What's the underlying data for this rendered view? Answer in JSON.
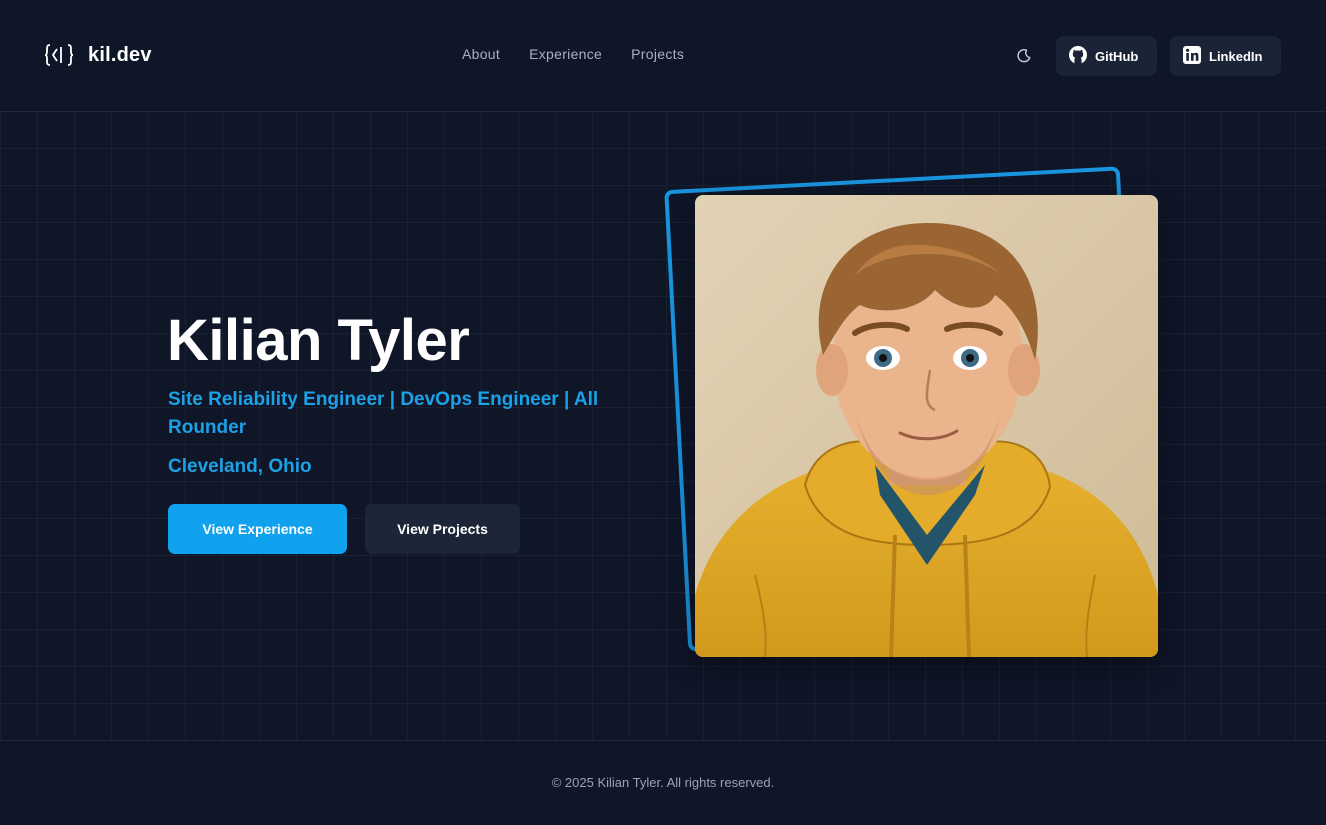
{
  "header": {
    "logo_text": "kil.dev",
    "nav": [
      {
        "label": "About"
      },
      {
        "label": "Experience"
      },
      {
        "label": "Projects"
      }
    ],
    "github_label": "GitHub",
    "linkedin_label": "LinkedIn"
  },
  "hero": {
    "name": "Kilian Tyler",
    "title": "Site Reliability Engineer | DevOps Engineer | All Rounder",
    "location": "Cleveland, Ohio",
    "primary_button": "View Experience",
    "secondary_button": "View Projects"
  },
  "footer": {
    "copyright": "© 2025 Kilian Tyler. All rights reserved."
  },
  "colors": {
    "background": "#0f1628",
    "accent": "#10a2ee",
    "accent_text": "#1ca0e6",
    "button_dark": "#1d2638"
  },
  "icons": {
    "logo": "code-braces-icon",
    "theme": "moon-icon",
    "github": "github-icon",
    "linkedin": "linkedin-icon"
  }
}
